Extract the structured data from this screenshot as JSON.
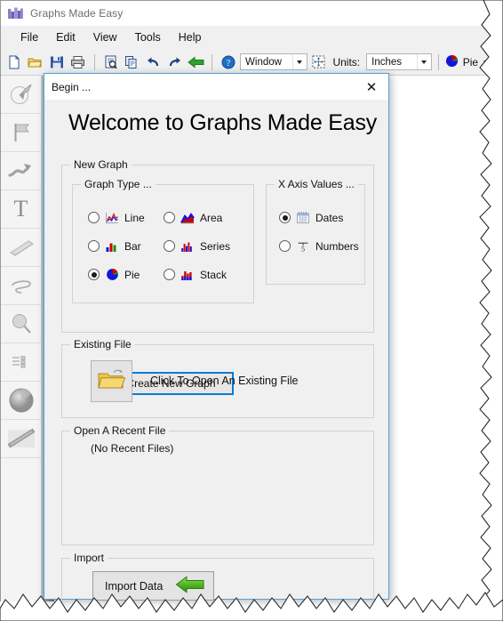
{
  "window": {
    "title": "Graphs Made Easy",
    "app_icon": "chart-icon"
  },
  "menu": {
    "items": [
      {
        "label": "File"
      },
      {
        "label": "Edit"
      },
      {
        "label": "View"
      },
      {
        "label": "Tools"
      },
      {
        "label": "Help"
      }
    ]
  },
  "toolbar": {
    "buttons": [
      {
        "name": "new-file-icon"
      },
      {
        "name": "open-file-icon"
      },
      {
        "name": "save-icon"
      },
      {
        "name": "print-icon"
      },
      {
        "name": "print-preview-icon"
      },
      {
        "name": "copy-icon"
      },
      {
        "name": "undo-icon"
      },
      {
        "name": "redo-icon"
      },
      {
        "name": "back-arrow-icon"
      }
    ],
    "help_icon": "help-icon",
    "window_combo_value": "Window",
    "fit_icon": "fit-to-window-icon",
    "units_label": "Units:",
    "units_combo_value": "Inches",
    "chart_type_icon": "pie-icon",
    "chart_type_value": "Pie"
  },
  "left_toolbar": {
    "items": [
      {
        "name": "pie-slice-tool-icon"
      },
      {
        "name": "flag-tool-icon"
      },
      {
        "name": "arrow-tool-icon"
      },
      {
        "name": "text-tool-icon"
      },
      {
        "name": "bar-tool-icon"
      },
      {
        "name": "freehand-tool-icon"
      },
      {
        "name": "magnifier-tool-icon"
      },
      {
        "name": "legend-tool-icon"
      },
      {
        "name": "sphere-tool-icon"
      },
      {
        "name": "line-tool-icon"
      }
    ]
  },
  "dialog": {
    "title": "Begin ...",
    "close_label": "✕",
    "heading": "Welcome to Graphs Made Easy",
    "new_graph": {
      "legend": "New Graph",
      "graph_type": {
        "legend": "Graph Type ...",
        "options": [
          {
            "label": "Line",
            "icon": "line-chart-icon",
            "checked": false
          },
          {
            "label": "Area",
            "icon": "area-chart-icon",
            "checked": false
          },
          {
            "label": "Bar",
            "icon": "bar-chart-icon",
            "checked": false
          },
          {
            "label": "Series",
            "icon": "series-chart-icon",
            "checked": false
          },
          {
            "label": "Pie",
            "icon": "pie-chart-icon",
            "checked": true
          },
          {
            "label": "Stack",
            "icon": "stack-chart-icon",
            "checked": false
          }
        ]
      },
      "x_axis": {
        "legend": "X Axis Values ...",
        "options": [
          {
            "label": "Dates",
            "icon": "calendar-icon",
            "checked": true
          },
          {
            "label": "Numbers",
            "icon": "ruler-icon",
            "checked": false
          }
        ]
      },
      "create_button": "Create New Graph"
    },
    "existing_file": {
      "legend": "Existing File",
      "icon": "open-folder-icon",
      "text": "Click To Open An Existing File"
    },
    "recent_file": {
      "legend": "Open A Recent File",
      "empty_text": "(No Recent Files)"
    },
    "import": {
      "legend": "Import",
      "button_label": "Import Data",
      "button_icon": "green-left-arrow-icon"
    }
  },
  "colors": {
    "accent": "#0a7cd4",
    "dialog_bg": "#f0f0f0",
    "chart_red": "#e00000",
    "chart_blue": "#1010e0",
    "chart_green": "#009000",
    "folder_yellow": "#f2cb4a",
    "import_green": "#4fb823"
  }
}
